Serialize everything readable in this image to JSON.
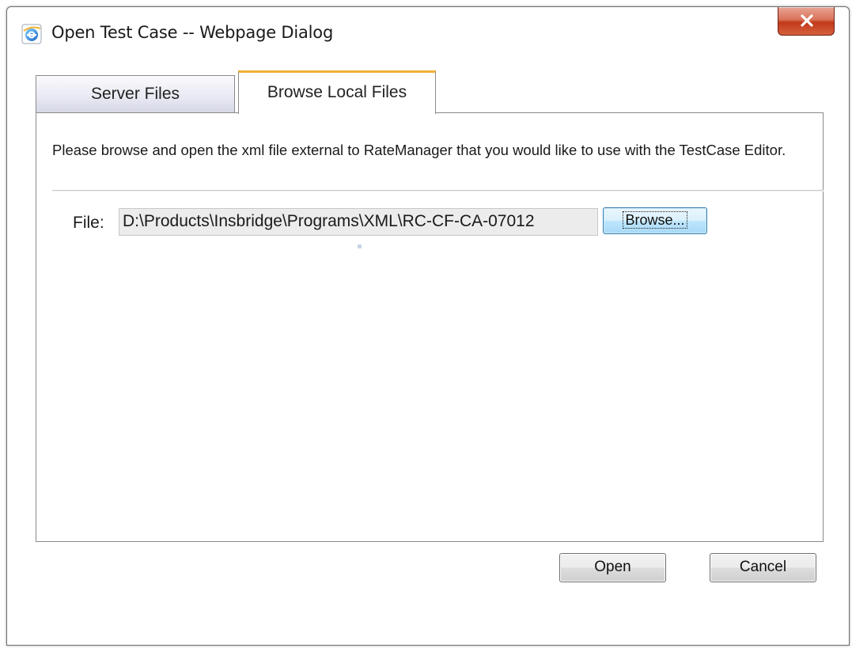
{
  "window": {
    "title": "Open Test Case -- Webpage Dialog",
    "icon": "internet-explorer-icon",
    "close_icon": "close-x-icon"
  },
  "tabs": [
    {
      "label": "Server Files",
      "active": false
    },
    {
      "label": "Browse Local Files",
      "active": true
    }
  ],
  "panel": {
    "instructions": "Please browse and open the xml file external to RateManager that you would like to use with the TestCase Editor.",
    "file_label": "File:",
    "file_value": "D:\\Products\\Insbridge\\Programs\\XML\\RC-CF-CA-07012",
    "browse_label": "Browse..."
  },
  "footer": {
    "open_label": "Open",
    "cancel_label": "Cancel"
  },
  "colors": {
    "active_tab_accent": "#f0b035",
    "close_button": "#c2391c",
    "focus_button_border": "#3c7fb1"
  }
}
